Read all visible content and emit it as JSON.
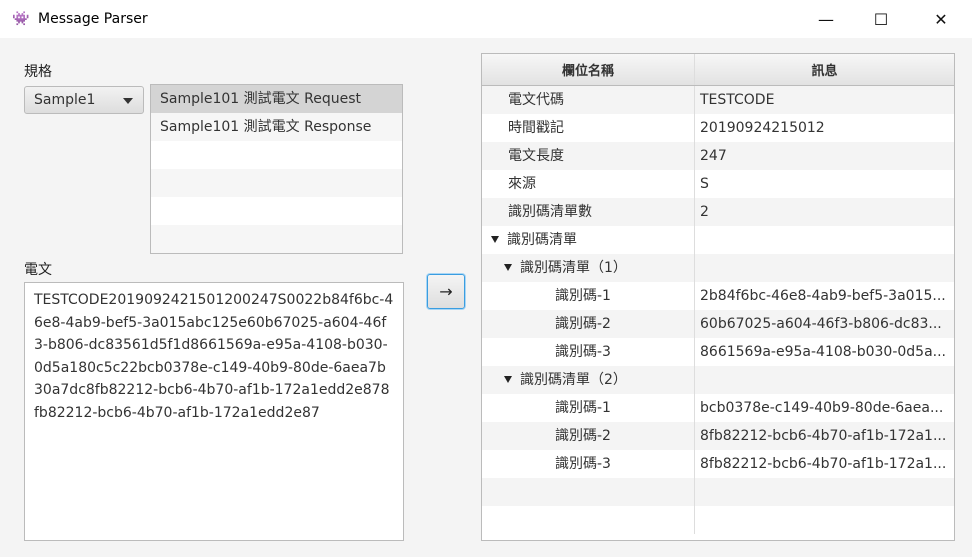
{
  "window": {
    "title": "Message Parser",
    "icon": "app-icon",
    "minimize": "—",
    "maximize": "☐",
    "close": "✕"
  },
  "left": {
    "spec_label": "規格",
    "combo_value": "Sample1",
    "list_items": [
      "Sample101 測試電文 Request",
      "Sample101 測試電文 Response"
    ],
    "message_label": "電文",
    "message_text": "TESTCODE2019092421501200247S0022b84f6bc-46e8-4ab9-bef5-3a015abc125e60b67025-a604-46f3-b806-dc83561d5f1d8661569a-e95a-4108-b030-0d5a180c5c22bcb0378e-c149-40b9-80de-6aea7b30a7dc8fb82212-bcb6-4b70-af1b-172a1edd2e878fb82212-bcb6-4b70-af1b-172a1edd2e87",
    "parse_button": "→"
  },
  "table": {
    "headers": [
      "欄位名稱",
      "訊息"
    ],
    "rows": [
      {
        "name": "電文代碼",
        "value": "TESTCODE",
        "level": 0
      },
      {
        "name": "時間戳記",
        "value": "20190924215012",
        "level": 0
      },
      {
        "name": "電文長度",
        "value": "247",
        "level": 0
      },
      {
        "name": "來源",
        "value": "S",
        "level": 0
      },
      {
        "name": "識別碼清單數",
        "value": "2",
        "level": 0
      },
      {
        "name": "識別碼清單",
        "value": "",
        "level": 0,
        "expanded": true
      },
      {
        "name": "識別碼清單（1）",
        "value": "",
        "level": 1,
        "expanded": true
      },
      {
        "name": "識別碼-1",
        "value": "2b84f6bc-46e8-4ab9-bef5-3a015...",
        "level": 2
      },
      {
        "name": "識別碼-2",
        "value": "60b67025-a604-46f3-b806-dc83...",
        "level": 2
      },
      {
        "name": "識別碼-3",
        "value": "8661569a-e95a-4108-b030-0d5a...",
        "level": 2
      },
      {
        "name": "識別碼清單（2）",
        "value": "",
        "level": 1,
        "expanded": true
      },
      {
        "name": "識別碼-1",
        "value": "bcb0378e-c149-40b9-80de-6aea...",
        "level": 2
      },
      {
        "name": "識別碼-2",
        "value": "8fb82212-bcb6-4b70-af1b-172a1...",
        "level": 2
      },
      {
        "name": "識別碼-3",
        "value": "8fb82212-bcb6-4b70-af1b-172a1...",
        "level": 2
      }
    ]
  }
}
